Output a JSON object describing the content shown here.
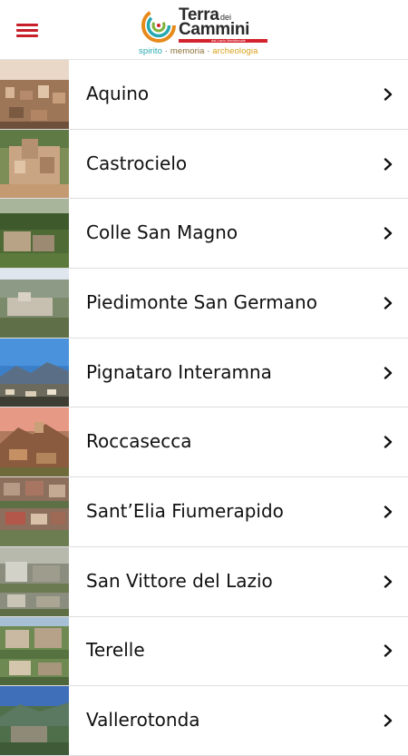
{
  "header": {
    "menu_icon": "hamburger-menu-icon",
    "logo": {
      "title_line1": "Terra",
      "title_dei": "dei",
      "title_line2": "Cammini",
      "bar_text": "dal Lazio Meridionale",
      "tag_word1": "spirito",
      "tag_word2": "memoria",
      "tag_word3": "archeologia",
      "tag_sep": "·"
    }
  },
  "colors": {
    "menu_red": "#c8202a",
    "logo_bar_red": "#d3232f",
    "logo_teal": "#26a8b0",
    "logo_orange": "#e88a1a",
    "logo_green": "#7fb23a"
  },
  "towns": [
    {
      "name": "Aquino",
      "icon": "chevron-right-icon"
    },
    {
      "name": "Castrocielo",
      "icon": "chevron-right-icon"
    },
    {
      "name": "Colle San Magno",
      "icon": "chevron-right-icon"
    },
    {
      "name": "Piedimonte San Germano",
      "icon": "chevron-right-icon"
    },
    {
      "name": "Pignataro Interamna",
      "icon": "chevron-right-icon"
    },
    {
      "name": "Roccasecca",
      "icon": "chevron-right-icon"
    },
    {
      "name": "Sant’Elia Fiumerapido",
      "icon": "chevron-right-icon"
    },
    {
      "name": "San Vittore del Lazio",
      "icon": "chevron-right-icon"
    },
    {
      "name": "Terelle",
      "icon": "chevron-right-icon"
    },
    {
      "name": "Vallerotonda",
      "icon": "chevron-right-icon"
    }
  ]
}
